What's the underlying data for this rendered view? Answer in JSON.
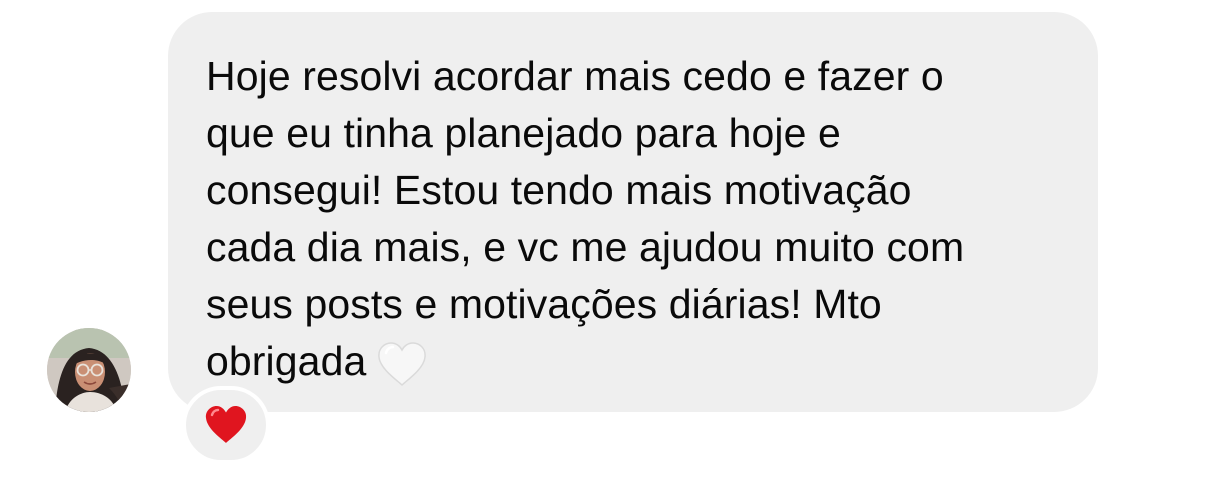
{
  "message": {
    "text": "Hoje resolvi acordar mais cedo e fazer o\nque eu tinha planejado para hoje e\nconsegui! Estou tendo mais motivação\ncada dia mais, e vc me ajudou muito com\nseus posts e motivações diárias! Mto\nobrigada",
    "trailing_emoji": "white-heart-icon",
    "reaction": "red-heart-icon"
  },
  "colors": {
    "bubble_bg": "#efefef",
    "text": "#0a0a0a",
    "reaction_heart": "#e0151f",
    "white_heart": "#f7f7f7"
  }
}
